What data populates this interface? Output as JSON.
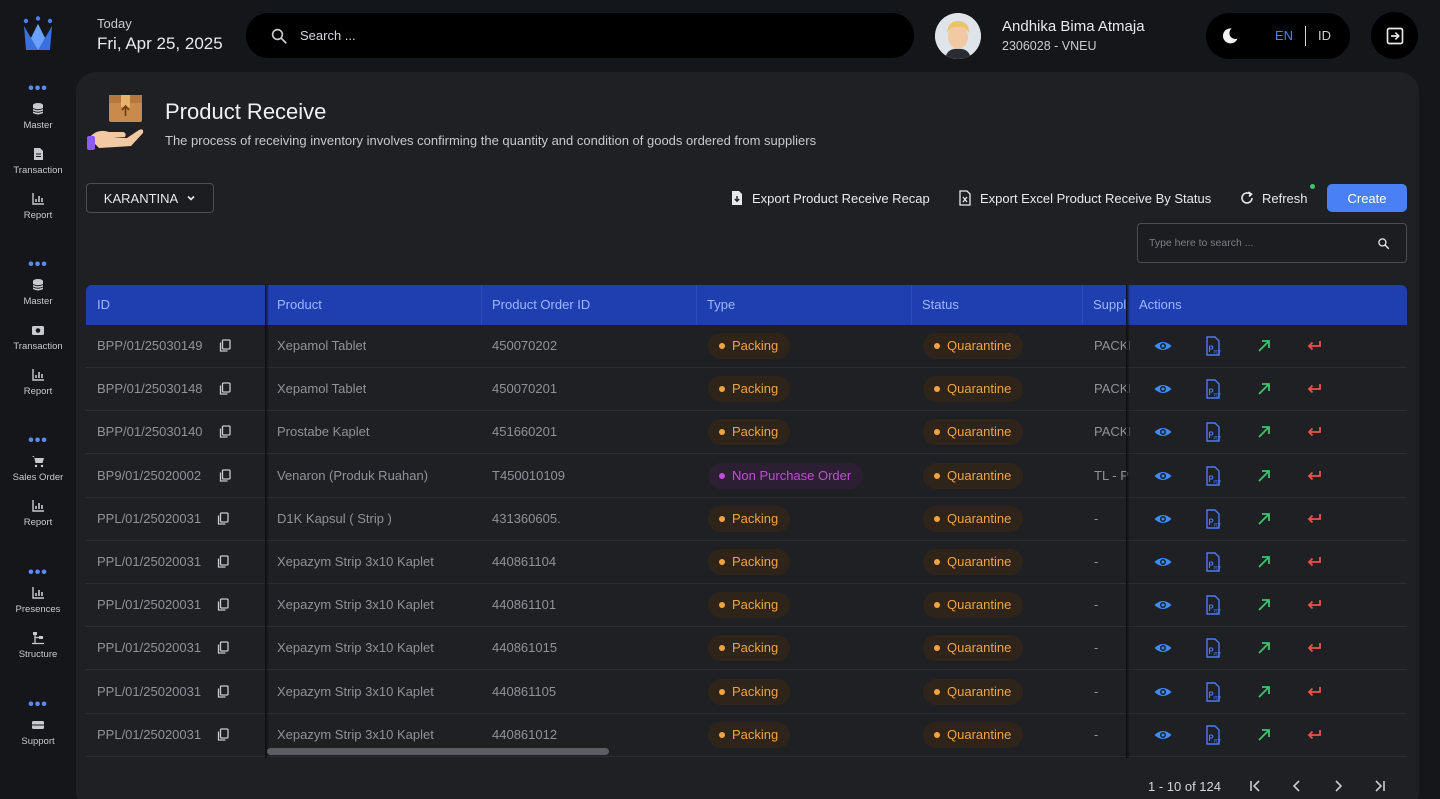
{
  "sidebar": {
    "groups": [
      {
        "items": [
          {
            "label": "Master",
            "icon": "database-icon"
          },
          {
            "label": "Transaction",
            "icon": "document-icon"
          },
          {
            "label": "Report",
            "icon": "bar-chart-icon"
          }
        ]
      },
      {
        "items": [
          {
            "label": "Master",
            "icon": "database-icon"
          },
          {
            "label": "Transaction",
            "icon": "camera-icon"
          },
          {
            "label": "Report",
            "icon": "bar-chart-icon"
          }
        ]
      },
      {
        "items": [
          {
            "label": "Sales Order",
            "icon": "cart-icon"
          },
          {
            "label": "Report",
            "icon": "bar-chart-icon"
          }
        ]
      },
      {
        "items": [
          {
            "label": "Presences",
            "icon": "bar-chart-icon"
          },
          {
            "label": "Structure",
            "icon": "structure-icon"
          }
        ]
      },
      {
        "items": [
          {
            "label": "Support",
            "icon": "support-icon"
          }
        ]
      }
    ]
  },
  "header": {
    "today_label": "Today",
    "date": "Fri, Apr 25, 2025",
    "search_placeholder": "Search ...",
    "user_name": "Andhika Bima Atmaja",
    "user_id": "2306028 -  VNEU",
    "lang_en": "EN",
    "lang_id": "ID"
  },
  "page": {
    "title": "Product Receive",
    "description": "The process of receiving inventory involves confirming the quantity and condition of goods ordered from suppliers"
  },
  "toolbar": {
    "filter_value": "KARANTINA",
    "export_recap": "Export Product Receive Recap",
    "export_excel": "Export Excel Product Receive By Status",
    "refresh": "Refresh",
    "create": "Create",
    "table_search_placeholder": "Type here to search ..."
  },
  "table": {
    "columns": [
      "ID",
      "Product",
      "Product Order ID",
      "Type",
      "Status",
      "Suppl",
      "Actions"
    ],
    "rows": [
      {
        "id": "BPP/01/25030149",
        "product": "Xepamol Tablet",
        "order_id": "450070202",
        "type": "Packing",
        "status": "Quarantine",
        "supplier": "PACKI"
      },
      {
        "id": "BPP/01/25030148",
        "product": "Xepamol Tablet",
        "order_id": "450070201",
        "type": "Packing",
        "status": "Quarantine",
        "supplier": "PACKI"
      },
      {
        "id": "BPP/01/25030140",
        "product": "Prostabe Kaplet",
        "order_id": "451660201",
        "type": "Packing",
        "status": "Quarantine",
        "supplier": "PACKI"
      },
      {
        "id": "BP9/01/25020002",
        "product": "Venaron (Produk Ruahan)",
        "order_id": "T450010109",
        "type": "Non Purchase Order",
        "status": "Quarantine",
        "supplier": "TL - P"
      },
      {
        "id": "PPL/01/25020031",
        "product": "D1K Kapsul ( Strip )",
        "order_id": "431360605.",
        "type": "Packing",
        "status": "Quarantine",
        "supplier": "-"
      },
      {
        "id": "PPL/01/25020031",
        "product": "Xepazym Strip 3x10 Kaplet",
        "order_id": "440861104",
        "type": "Packing",
        "status": "Quarantine",
        "supplier": "-"
      },
      {
        "id": "PPL/01/25020031",
        "product": "Xepazym Strip 3x10 Kaplet",
        "order_id": "440861101",
        "type": "Packing",
        "status": "Quarantine",
        "supplier": "-"
      },
      {
        "id": "PPL/01/25020031",
        "product": "Xepazym Strip 3x10 Kaplet",
        "order_id": "440861015",
        "type": "Packing",
        "status": "Quarantine",
        "supplier": "-"
      },
      {
        "id": "PPL/01/25020031",
        "product": "Xepazym Strip 3x10 Kaplet",
        "order_id": "440861105",
        "type": "Packing",
        "status": "Quarantine",
        "supplier": "-"
      },
      {
        "id": "PPL/01/25020031",
        "product": "Xepazym Strip 3x10 Kaplet",
        "order_id": "440861012",
        "type": "Packing",
        "status": "Quarantine",
        "supplier": "-"
      }
    ]
  },
  "pagination": {
    "text": "1 - 10 of 124"
  },
  "colors": {
    "accent": "#4a80f5",
    "header_bg": "#1f3fb0",
    "badge_orange": "#f4a340",
    "badge_purple": "#c04cd7",
    "action_view": "#3d8bff",
    "action_pdf": "#4a7cf5",
    "action_send": "#3fc46b",
    "action_return": "#f0524a"
  }
}
